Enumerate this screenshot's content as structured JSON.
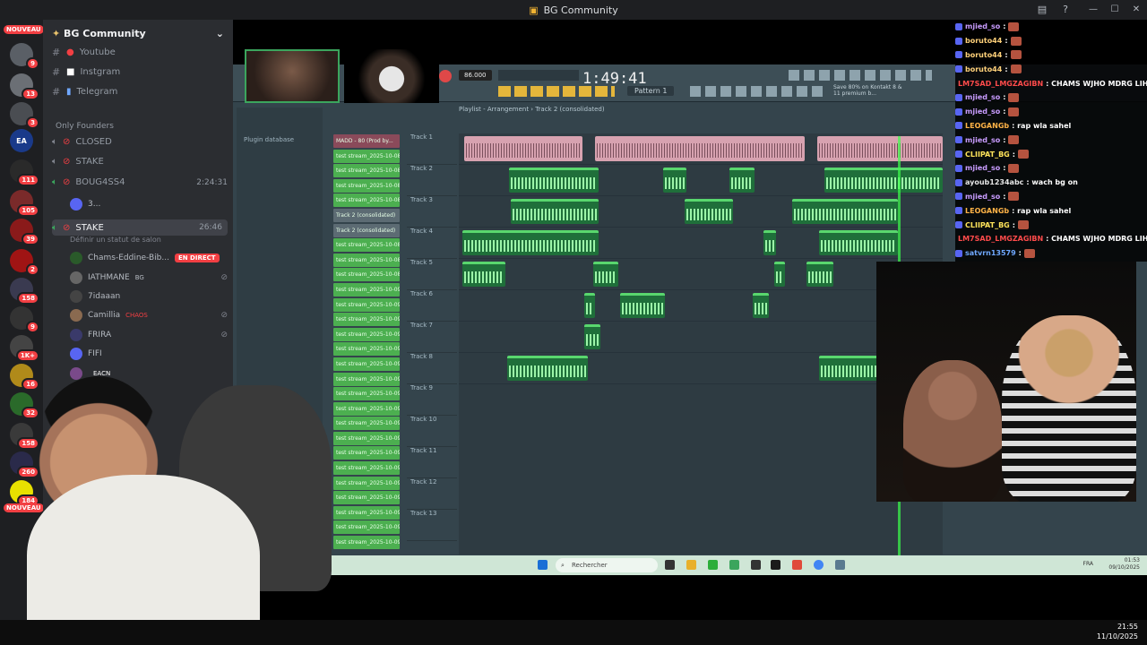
{
  "window": {
    "title": "BG Community"
  },
  "server": {
    "name": "BG Community"
  },
  "rail": {
    "new_label": "NOUVEAU",
    "badges": [
      "9",
      "13",
      "3",
      "",
      "111",
      "105",
      "39",
      "2",
      "158",
      "9",
      "1K+",
      "16",
      "32",
      "158",
      "260",
      "184"
    ]
  },
  "channels": {
    "text": [
      {
        "name": "Youtube"
      },
      {
        "name": "Instgram"
      },
      {
        "name": "Telegram"
      }
    ],
    "category": "Only Founders",
    "voice": [
      {
        "name": "CLOSED",
        "time": ""
      },
      {
        "name": "STAKE",
        "time": ""
      },
      {
        "name": "BOUG4SS4",
        "time": "2:24:31"
      },
      {
        "name": "3...",
        "time": ""
      },
      {
        "name": "STAKE",
        "time": "26:46"
      }
    ],
    "status_hint": "Définir un statut de salon",
    "users": [
      {
        "name": "Chams-Eddine-Bib...",
        "tag": "EN DIRECT"
      },
      {
        "name": "IATHMANE",
        "tag": "BG"
      },
      {
        "name": "7idaaan",
        "tag": ""
      },
      {
        "name": "Camillia",
        "tag": "CHAOS"
      },
      {
        "name": "FRIRA",
        "tag": ""
      },
      {
        "name": "FIFI",
        "tag": ""
      },
      {
        "name": "",
        "tag": "EACN"
      }
    ]
  },
  "fl": {
    "time": "1:49:41",
    "tempo": "86.000",
    "pattern": "Pattern 1",
    "playlist_title": "Playlist - Arrangement › Track 2 (consolidated)",
    "plugin_db": "Plugin database",
    "save_note": "Save 80% on Kontakt 8 & 11 premium b..."
  },
  "picker": [
    "MADD - 80 (Prod by...",
    "test stream_2025-10-08...",
    "test stream_2025-10-08...",
    "test stream_2025-10-08...",
    "test stream_2025-10-08...",
    "Track 2 (consolidated)",
    "Track 2 (consolidated)",
    "test stream_2025-10-08...",
    "test stream_2025-10-08...",
    "test stream_2025-10-08...",
    "test stream_2025-10-09...",
    "test stream_2025-10-09...",
    "test stream_2025-10-09...",
    "test stream_2025-10-09...",
    "test stream_2025-10-09...",
    "test stream_2025-10-09...",
    "test stream_2025-10-09...",
    "test stream_2025-10-09...",
    "test stream_2025-10-09...",
    "test stream_2025-10-09...",
    "test stream_2025-10-09...",
    "test stream_2025-10-09...",
    "test stream_2025-10-09...",
    "test stream_2025-10-09...",
    "test stream_2025-10-09...",
    "test stream_2025-10-09...",
    "test stream_2025-10-09...",
    "test stream_2025-10-09..."
  ],
  "tracks": [
    "Track 1",
    "Track 2",
    "Track 3",
    "Track 4",
    "Track 5",
    "Track 6",
    "Track 7",
    "Track 8",
    "Track 9",
    "Track 10",
    "Track 11",
    "Track 12",
    "Track 13"
  ],
  "chat": [
    {
      "user": "mjied_so",
      "msg": ":",
      "color": "#c99cff"
    },
    {
      "user": "boruto44",
      "msg": ":",
      "color": "#ffd17a"
    },
    {
      "user": "boruto44",
      "msg": ":",
      "color": "#ffd17a"
    },
    {
      "user": "boruto44",
      "msg": ":",
      "color": "#ffd17a"
    },
    {
      "user": "LM7SAD_LMGZAGIBN",
      "msg": ": CHAMS WJHO MDRG LIH ZBO",
      "color": "#ff4b4b"
    },
    {
      "user": "mjied_so",
      "msg": ":",
      "color": "#c99cff"
    },
    {
      "user": "mjied_so",
      "msg": ":",
      "color": "#c99cff"
    },
    {
      "user": "LEOGANGb",
      "msg": ": rap wla sahel",
      "color": "#ffb347"
    },
    {
      "user": "mjied_so",
      "msg": ":",
      "color": "#c99cff"
    },
    {
      "user": "CLIIPAT_BG",
      "msg": ":",
      "color": "#ffe35a"
    },
    {
      "user": "mjied_so",
      "msg": ":",
      "color": "#c99cff"
    },
    {
      "user": "ayoub1234abc",
      "msg": ": wach bg on",
      "color": "#e6e6e6"
    },
    {
      "user": "mjied_so",
      "msg": ":",
      "color": "#c99cff"
    },
    {
      "user": "LEOGANGb",
      "msg": ": rap wla sahel",
      "color": "#ffb347"
    },
    {
      "user": "CLIIPAT_BG",
      "msg": ":",
      "color": "#ffe35a"
    },
    {
      "user": "LM7SAD_LMGZAGIBN",
      "msg": ": CHAMS WJHO MDRG LIH ZBO",
      "color": "#ff4b4b"
    },
    {
      "user": "satvrn13579",
      "msg": ":",
      "color": "#6fa8ff"
    }
  ],
  "taskbar": {
    "search_placeholder": "Rechercher",
    "lang": "FRA",
    "time": "01:53",
    "date": "09/10/2025"
  },
  "system_clock": {
    "time": "21:55",
    "date": "11/10/2025"
  },
  "colors": {
    "accent_green": "#3ba55d",
    "live_red": "#f23f43",
    "fl_bg": "#34444c"
  }
}
